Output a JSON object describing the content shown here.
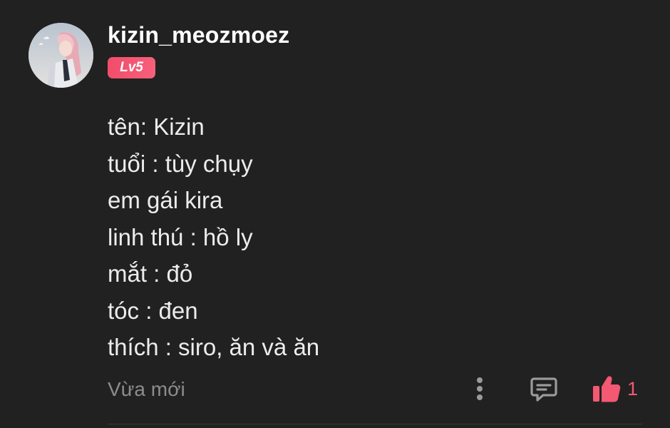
{
  "comment": {
    "username": "kizin_meozmoez",
    "level": "Lv5",
    "lines": [
      "tên: Kizin",
      "tuổi : tùy chụy",
      "em gái kira",
      "linh thú : hồ ly",
      "mắt : đỏ",
      "tóc : đen",
      "thích : siro, ăn và ăn"
    ],
    "timestamp": "Vừa mới",
    "like_count": "1",
    "icons": {
      "more": "more-vertical-icon",
      "reply": "comment-reply-icon",
      "like": "thumbs-up-icon"
    },
    "colors": {
      "background": "#212121",
      "accent": "#f45872",
      "muted_text": "#8c8c8c"
    }
  }
}
